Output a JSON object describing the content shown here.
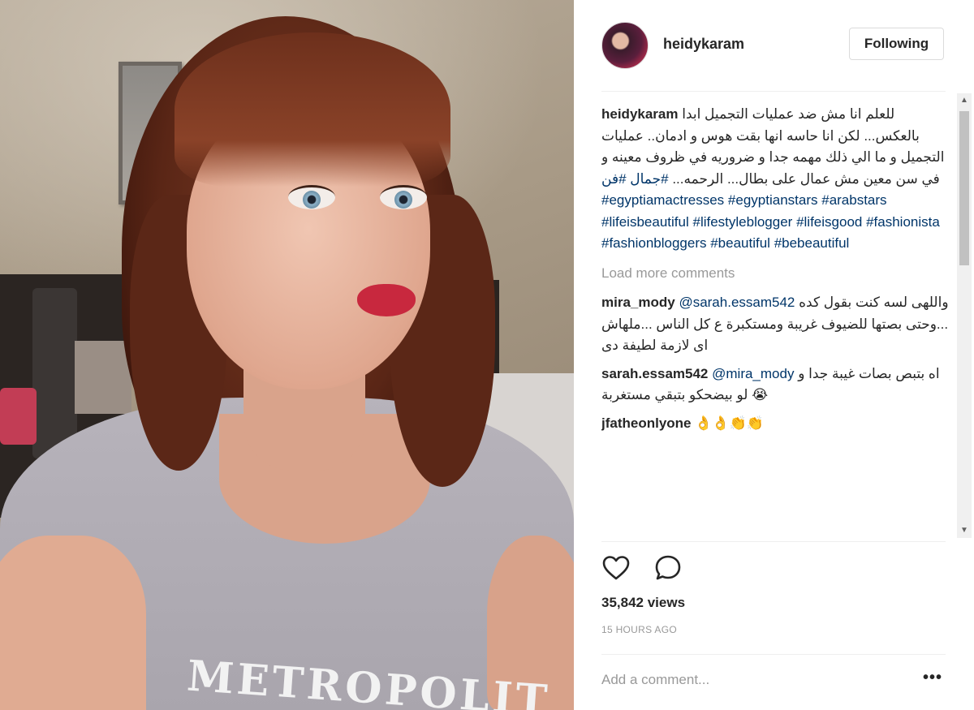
{
  "header": {
    "username": "heidykaram",
    "follow_label": "Following"
  },
  "caption": {
    "username": "heidykaram",
    "text": "للعلم انا مش ضد عمليات التجميل ابدا بالعكس... لكن انا حاسه انها بقت هوس و ادمان.. عمليات التجميل و ما الي ذلك مهمه جدا و ضروريه في ظروف معينه و في سن معين مش عمال على بطال... الرحمه...",
    "tags": [
      "#جمال",
      "#فن",
      "#egyptiamactresses",
      "#egyptianstars",
      "#arabstars",
      "#lifeisbeautiful",
      "#lifestyleblogger",
      "#lifeisgood",
      "#fashionista",
      "#fashionbloggers",
      "#beautiful",
      "#bebeautiful"
    ]
  },
  "load_more": "Load more comments",
  "comments": [
    {
      "username": "mira_mody",
      "mention": "@sarah.essam542",
      "text": "واللهى لسه كنت بقول كده ...وحتى بصتها للضيوف غريبة ومستكبرة ع كل الناس ...ملهاش اى لازمة لطيفة دى"
    },
    {
      "username": "sarah.essam542",
      "mention": "@mira_mody",
      "text": "اه بتبص بصات غيبة جدا و لو بيضحكو بتبقي مستغربة 😭"
    },
    {
      "username": "jfatheonlyone",
      "mention": "",
      "text": "👌👌👏👏"
    }
  ],
  "stats": {
    "views": "35,842 views",
    "time": "15 HOURS AGO"
  },
  "add_comment": {
    "placeholder": "Add a comment..."
  },
  "more_label": "•••",
  "icons": {
    "like": "heart-outline-icon",
    "comment": "speech-bubble-icon"
  },
  "media": {
    "shirt_print": "METROPOLIT"
  },
  "scrollbar": {
    "up": "▲",
    "down": "▼"
  },
  "colors": {
    "hashtag": "#003569",
    "muted": "#999999",
    "text": "#262626"
  }
}
